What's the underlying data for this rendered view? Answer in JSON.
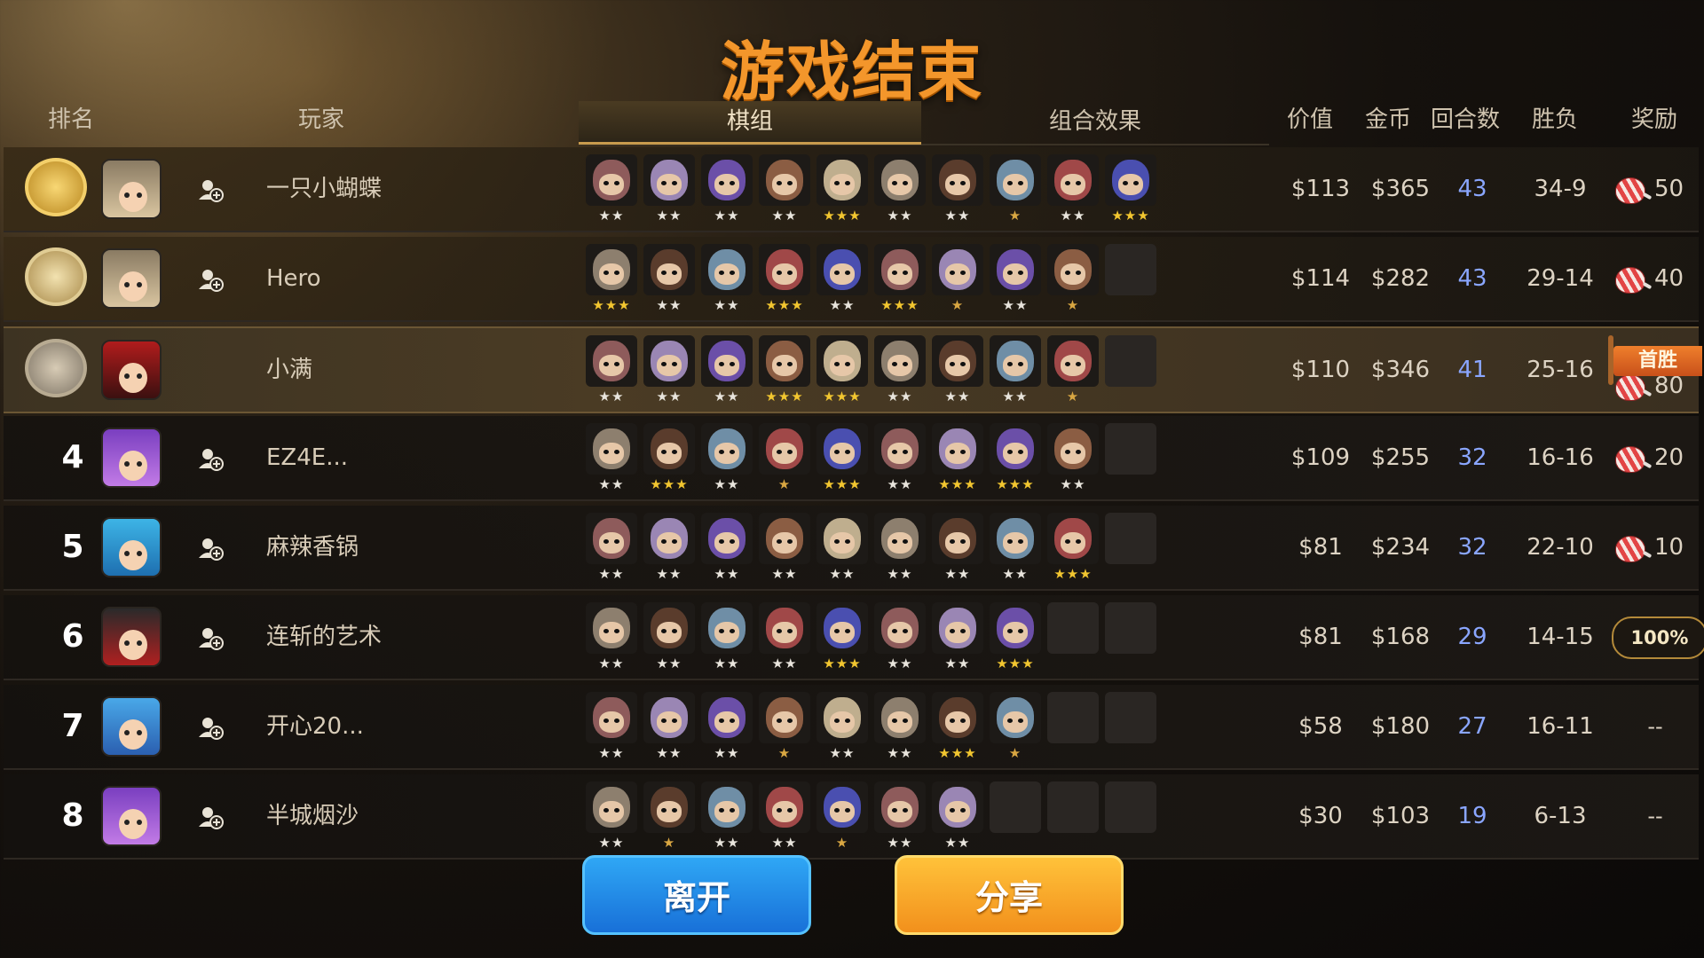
{
  "title": "游戏结束",
  "headers": {
    "rank": "排名",
    "player": "玩家",
    "tab_lineup": "棋组",
    "tab_synergy": "组合效果",
    "value": "价值",
    "gold": "金币",
    "rounds": "回合数",
    "winloss": "胜负",
    "reward": "奖励"
  },
  "buttons": {
    "leave": "离开",
    "share": "分享"
  },
  "first_win_label": "首胜",
  "rows": [
    {
      "rank": "1",
      "medal": "gold-medal-icon",
      "avatar": "avatar-blonde-hero",
      "name": "一只小蝴蝶",
      "value": "$113",
      "gold": "$365",
      "rounds": "43",
      "wl": "34-9",
      "reward": "50",
      "reward_type": "candy",
      "pieces": [
        2,
        2,
        2,
        2,
        3,
        2,
        2,
        1,
        2,
        3
      ]
    },
    {
      "rank": "2",
      "medal": "silver-medal-icon",
      "avatar": "avatar-blonde-hero",
      "name": "Hero",
      "value": "$114",
      "gold": "$282",
      "rounds": "43",
      "wl": "29-14",
      "reward": "40",
      "reward_type": "candy",
      "pieces": [
        3,
        2,
        2,
        3,
        2,
        3,
        1,
        2,
        1,
        0
      ]
    },
    {
      "rank": "3",
      "medal": "bronze-medal-icon",
      "avatar": "avatar-red-ninja",
      "name": "小满",
      "value": "$110",
      "gold": "$346",
      "rounds": "41",
      "wl": "25-16",
      "reward": "80",
      "reward_type": "candy-firstwin",
      "pieces": [
        2,
        2,
        2,
        3,
        3,
        2,
        2,
        2,
        1,
        0
      ]
    },
    {
      "rank": "4",
      "medal": "",
      "avatar": "avatar-purple-girl",
      "name": "EZ4E...",
      "value": "$109",
      "gold": "$255",
      "rounds": "32",
      "wl": "16-16",
      "reward": "20",
      "reward_type": "candy",
      "pieces": [
        2,
        3,
        2,
        1,
        3,
        2,
        3,
        3,
        2,
        0
      ]
    },
    {
      "rank": "5",
      "medal": "",
      "avatar": "avatar-blue-hair",
      "name": "麻辣香锅",
      "value": "$81",
      "gold": "$234",
      "rounds": "32",
      "wl": "22-10",
      "reward": "10",
      "reward_type": "candy",
      "pieces": [
        2,
        2,
        2,
        2,
        2,
        2,
        2,
        2,
        3,
        0
      ]
    },
    {
      "rank": "6",
      "medal": "",
      "avatar": "avatar-dark-ninja",
      "name": "连斩的艺术",
      "value": "$81",
      "gold": "$168",
      "rounds": "29",
      "wl": "14-15",
      "reward": "100%",
      "reward_type": "percent",
      "pieces": [
        2,
        2,
        2,
        2,
        3,
        2,
        2,
        3,
        0,
        0
      ]
    },
    {
      "rank": "7",
      "medal": "",
      "avatar": "avatar-blue-bird",
      "name": "开心20...",
      "value": "$58",
      "gold": "$180",
      "rounds": "27",
      "wl": "16-11",
      "reward": "--",
      "reward_type": "none",
      "pieces": [
        2,
        2,
        2,
        1,
        2,
        2,
        3,
        1,
        0,
        0
      ]
    },
    {
      "rank": "8",
      "medal": "",
      "avatar": "avatar-purple-girl",
      "name": "半城烟沙",
      "value": "$30",
      "gold": "$103",
      "rounds": "19",
      "wl": "6-13",
      "reward": "--",
      "reward_type": "none",
      "pieces": [
        2,
        1,
        2,
        2,
        1,
        2,
        2,
        0,
        0,
        0
      ]
    }
  ],
  "colors": {
    "title": "#f3962b",
    "round_count": "#8aa6ff",
    "leave_button": "#1f86e4",
    "share_button": "#f7a82a"
  }
}
